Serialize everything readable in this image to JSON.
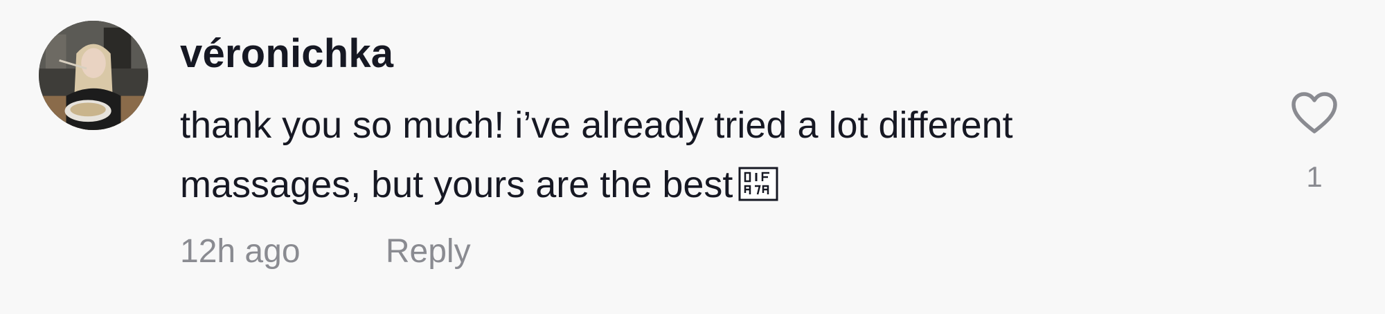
{
  "comment": {
    "username": "véronichka",
    "text_lines": [
      "thank you so much! i’ve already tried a lot different",
      "massages, but yours are the best"
    ],
    "emoji": "unrendered-emoji-placeholder",
    "timestamp": "12h ago",
    "reply_label": "Reply",
    "like_count": "1",
    "like_icon": "heart-outline-icon"
  },
  "colors": {
    "background": "#f8f8f8",
    "primary_text": "#161823",
    "secondary_text": "#8a8b91"
  }
}
